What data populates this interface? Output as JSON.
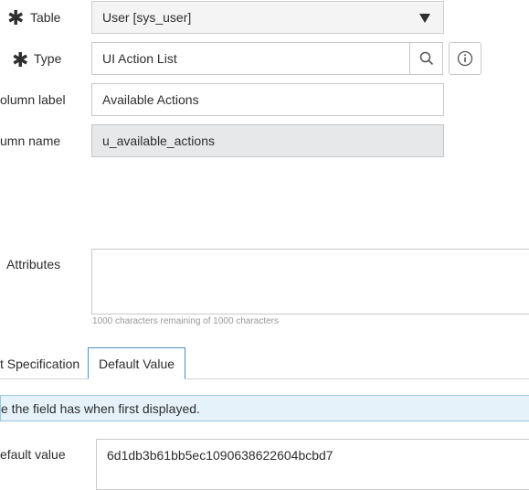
{
  "form": {
    "table": {
      "label": "Table",
      "required_mark": "✱",
      "value": "User [sys_user]"
    },
    "type": {
      "label": "Type",
      "required_mark": "✱",
      "value": "UI Action List"
    },
    "column_label": {
      "label": "olumn label",
      "value": "Available Actions"
    },
    "column_name": {
      "label": "umn name",
      "value": "u_available_actions"
    },
    "attributes": {
      "label": "Attributes",
      "value": "",
      "hint": "1000 characters remaining of 1000 characters"
    }
  },
  "tabs": [
    {
      "label": "t Specification",
      "active": false
    },
    {
      "label": "Default Value",
      "active": true
    }
  ],
  "default_value_section": {
    "info_text": "e the field has when first displayed.",
    "label": "efault value",
    "value": "6d1db3b61bb5ec1090638622604bcbd7"
  },
  "icons": {
    "search": "search-icon",
    "info": "info-icon",
    "dropdown": "chevron-down-icon"
  }
}
